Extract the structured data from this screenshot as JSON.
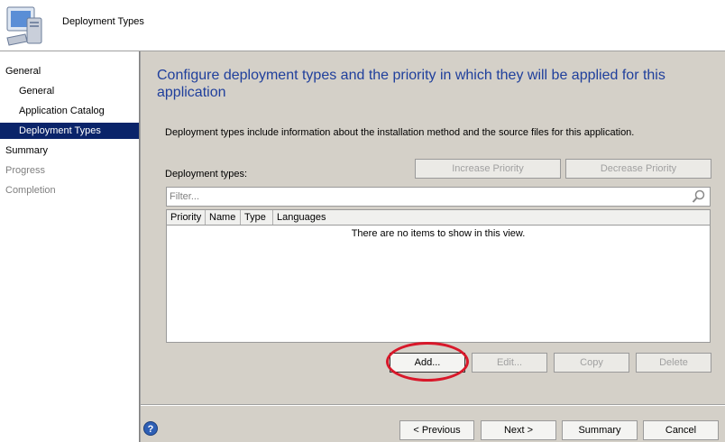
{
  "header": {
    "title": "Deployment Types",
    "icon": "computer-icon"
  },
  "sidebar": {
    "items": [
      {
        "label": "General",
        "level": 0,
        "state": "normal"
      },
      {
        "label": "General",
        "level": 1,
        "state": "normal"
      },
      {
        "label": "Application Catalog",
        "level": 1,
        "state": "normal"
      },
      {
        "label": "Deployment Types",
        "level": 1,
        "state": "selected"
      },
      {
        "label": "Summary",
        "level": 0,
        "state": "normal"
      },
      {
        "label": "Progress",
        "level": 0,
        "state": "disabled"
      },
      {
        "label": "Completion",
        "level": 0,
        "state": "disabled"
      }
    ]
  },
  "main": {
    "heading": "Configure deployment types and the priority in which they will be applied for this application",
    "description": "Deployment types include information about the installation method and the source files for this application.",
    "list_label": "Deployment types:",
    "increase_priority": "Increase Priority",
    "decrease_priority": "Decrease Priority",
    "filter_placeholder": "Filter...",
    "columns": [
      "Priority",
      "Name",
      "Type",
      "Languages"
    ],
    "empty_message": "There are no items to show in this view.",
    "add": "Add...",
    "edit": "Edit...",
    "copy": "Copy",
    "delete": "Delete"
  },
  "footer": {
    "previous": "< Previous",
    "next": "Next >",
    "summary": "Summary",
    "cancel": "Cancel",
    "help_icon": "help-icon"
  },
  "colors": {
    "selection": "#0a246a",
    "heading": "#1f3f9c",
    "highlight": "#d8182a"
  }
}
